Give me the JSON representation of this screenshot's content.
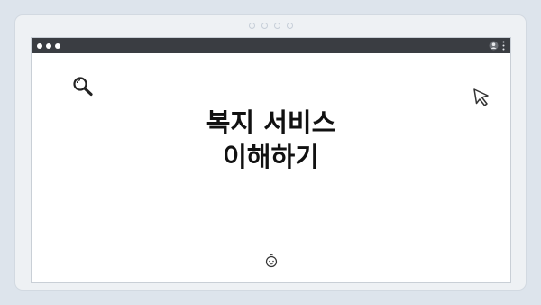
{
  "card": {
    "pager_count": 4
  },
  "window": {
    "traffic_lights": 3
  },
  "main": {
    "heading_line1": "복지 서비스",
    "heading_line2": "이해하기"
  },
  "icons": {
    "search": "search-icon",
    "cursor": "cursor-arrow-icon",
    "user": "user-icon",
    "menu": "vertical-dots-icon",
    "baby": "baby-face-icon"
  },
  "colors": {
    "background": "#dde4ec",
    "card": "#eef1f4",
    "titlebar": "#3a3d42",
    "window": "#ffffff",
    "heading": "#111111"
  }
}
